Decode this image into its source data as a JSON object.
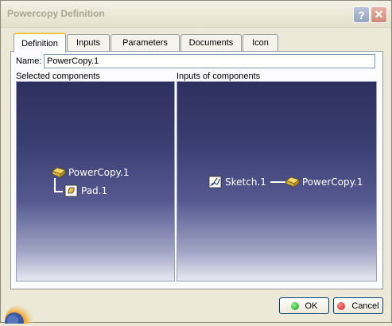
{
  "window": {
    "title": "Powercopy Definition"
  },
  "titlebar": {
    "help_label": "?",
    "close_label": "✕"
  },
  "tabs": [
    {
      "label": "Definition",
      "active": true
    },
    {
      "label": "Inputs",
      "active": false
    },
    {
      "label": "Parameters",
      "active": false
    },
    {
      "label": "Documents",
      "active": false
    },
    {
      "label": "Icon",
      "active": false
    }
  ],
  "name_field": {
    "label": "Name:",
    "value": "PowerCopy.1"
  },
  "selected_components": {
    "label": "Selected components",
    "root": "PowerCopy.1",
    "child": "Pad.1"
  },
  "inputs_of_components": {
    "label": "Inputs of components",
    "input": "Sketch.1",
    "target": "PowerCopy.1"
  },
  "buttons": {
    "ok": "OK",
    "cancel": "Cancel"
  },
  "colors": {
    "ok_dot": "#1e9a1e",
    "cancel_dot": "#c81e1e",
    "viewer_top": "#2e3060"
  }
}
